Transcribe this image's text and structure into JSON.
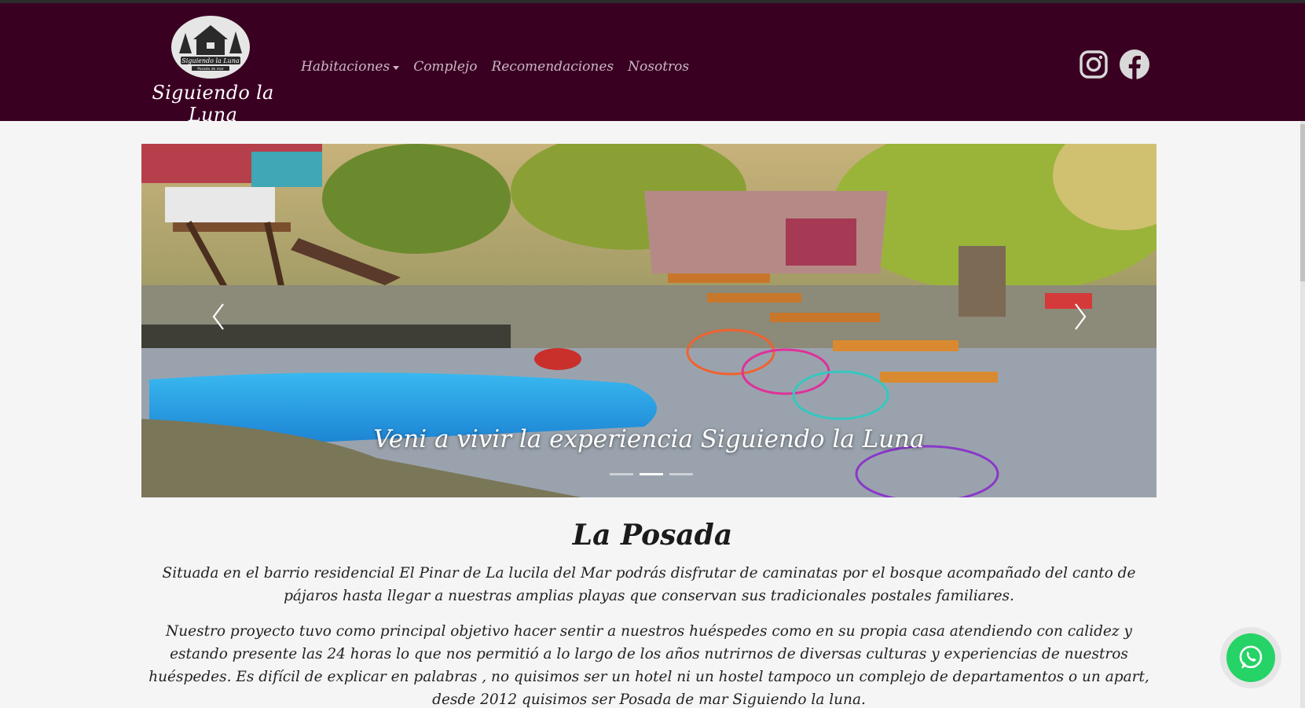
{
  "brand": {
    "name": "Siguiendo la Luna",
    "logo_text": "Siguiendo la Luna",
    "logo_subtext": "Posada de mar"
  },
  "nav": {
    "items": [
      {
        "label": "Habitaciones",
        "dropdown": true
      },
      {
        "label": "Complejo"
      },
      {
        "label": "Recomendaciones"
      },
      {
        "label": "Nosotros"
      }
    ]
  },
  "social": {
    "instagram": "instagram-icon",
    "facebook": "facebook-icon"
  },
  "carousel": {
    "caption": "Veni a vivir la experiencia Siguiendo la Luna",
    "slides": 3,
    "active_slide": 2
  },
  "section": {
    "title": "La Posada",
    "paragraphs": [
      "Situada en el barrio residencial El Pinar de La lucila del Mar podrás disfrutar de caminatas por el bosque acompañado del canto de pájaros hasta llegar a nuestras amplias playas que conservan sus tradicionales postales familiares.",
      "Nuestro proyecto tuvo como principal objetivo hacer sentir a nuestros huéspedes como en su propia casa atendiendo con calidez y estando presente las 24 horas lo que nos permitió a lo largo de los años nutrirnos de diversas culturas y experiencias de nuestros huéspedes. Es difícil de explicar en palabras , no quisimos ser un hotel ni un hostel tampoco un complejo de departamentos o un apart, desde 2012 quisimos ser Posada de mar Siguiendo la luna."
    ]
  },
  "colors": {
    "navbar": "#3a0022",
    "whatsapp": "#25d366",
    "page_bg": "#f5f5f5"
  }
}
